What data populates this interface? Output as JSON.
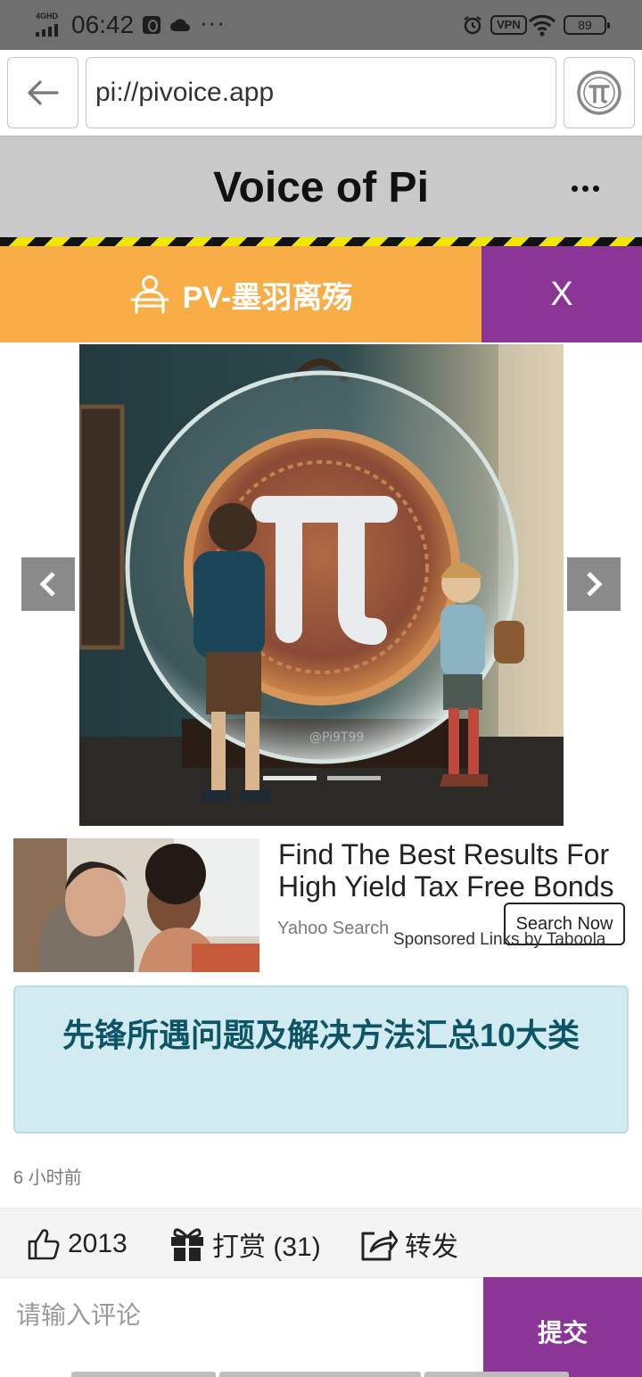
{
  "status_bar": {
    "network": "4GHD",
    "time": "06:42",
    "more": "···",
    "vpn": "VPN",
    "battery": "89"
  },
  "browser": {
    "url": "pi://pivoice.app",
    "icons": {
      "back": "back-arrow-icon",
      "pi": "pi-logo-icon"
    }
  },
  "header": {
    "title": "Voice of Pi",
    "more_icon": "ellipsis-icon"
  },
  "banner": {
    "user_name": "PV-墨羽离殇",
    "close_label": "X",
    "color": "#f9ad46",
    "accent": "#8b3597"
  },
  "carousel": {
    "watermark": "@Pi9T99",
    "slide_count": 2,
    "active_slide": 1
  },
  "ad": {
    "headline": "Find The Best Results For High Yield Tax Free Bonds",
    "source": "Yahoo Search",
    "cta": "Search Now",
    "sponsor": "Sponsored Links by Taboola"
  },
  "article": {
    "title": "先锋所遇问题及解决方法汇总10大类",
    "time_ago": "6 小时前"
  },
  "actions": {
    "likes": "2013",
    "tip_label": "打赏 (31)",
    "share_label": "转发"
  },
  "comment": {
    "placeholder": "请输入评论",
    "submit": "提交"
  }
}
